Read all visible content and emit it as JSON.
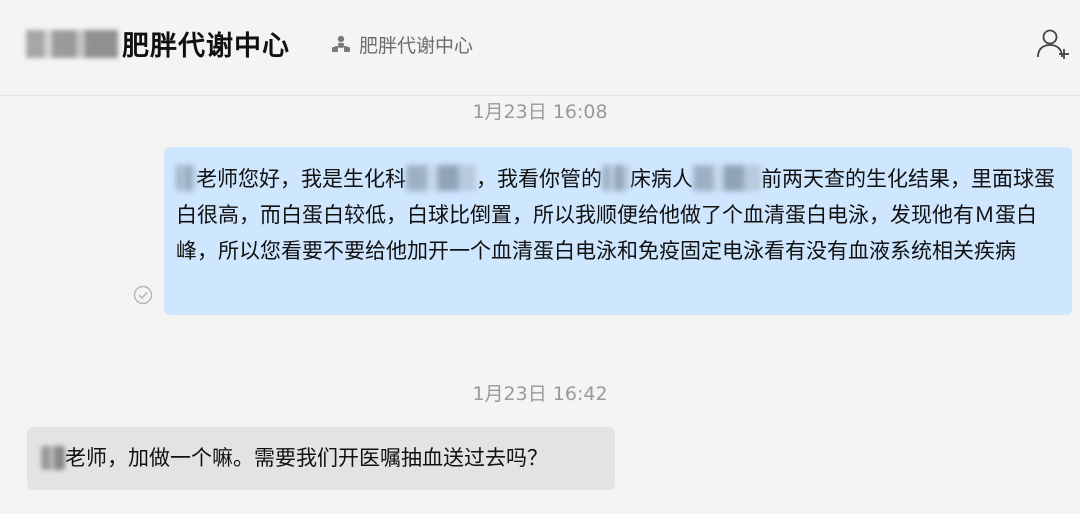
{
  "header": {
    "title": "肥胖代谢中心",
    "group_name": "肥胖代谢中心",
    "icons": {
      "group": "group-icon",
      "add_member": "add-member-icon"
    }
  },
  "messages": [
    {
      "timestamp": "1月23日 16:08",
      "direction": "outgoing",
      "status_icon": "sent-check-icon",
      "parts": {
        "p1": "老师您好，我是生化科",
        "p2": "，我看你管的",
        "p3": "床病人",
        "p4": "前两天查的生化结果，里面球蛋白很高，而白蛋白较低，白球比倒置，所以我顺便给他做了个血清蛋白电泳，发现他有Ｍ蛋白峰，所以您看要不要给他加开一个血清蛋白电泳和免疫固定电泳看有没有血液系统相关疾病"
      }
    },
    {
      "timestamp": "1月23日 16:42",
      "direction": "incoming",
      "parts": {
        "p1": "老师，加做一个嘛。需要我们开医嘱抽血送过去吗？"
      }
    }
  ],
  "colors": {
    "background": "#f4f4f4",
    "outgoing_bubble": "#cfe6ff",
    "incoming_bubble": "#e3e3e3",
    "timestamp": "#9a9a9a"
  }
}
